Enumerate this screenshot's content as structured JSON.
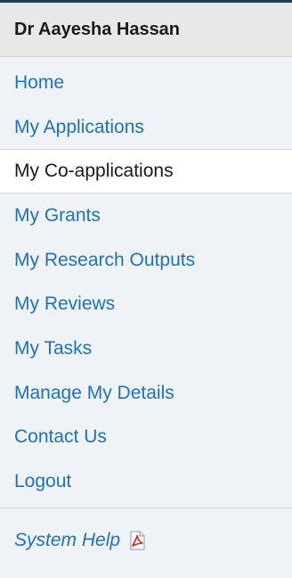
{
  "header": {
    "user_name": "Dr Aayesha Hassan"
  },
  "nav": {
    "items": [
      {
        "label": "Home"
      },
      {
        "label": "My Applications"
      },
      {
        "label": "My Co-applications",
        "active": true
      },
      {
        "label": "My Grants"
      },
      {
        "label": "My Research Outputs"
      },
      {
        "label": "My Reviews"
      },
      {
        "label": "My Tasks"
      },
      {
        "label": "Manage My Details"
      },
      {
        "label": "Contact Us"
      },
      {
        "label": "Logout"
      }
    ]
  },
  "help": {
    "label": "System Help",
    "icon": "pdf-icon"
  },
  "colors": {
    "link": "#2272b8",
    "header_bg": "#e8e8e8",
    "sidebar_bg": "#eff2f6",
    "active_bg": "#ffffff",
    "top_bar": "#1f3b63",
    "pdf_red": "#d8261e"
  }
}
